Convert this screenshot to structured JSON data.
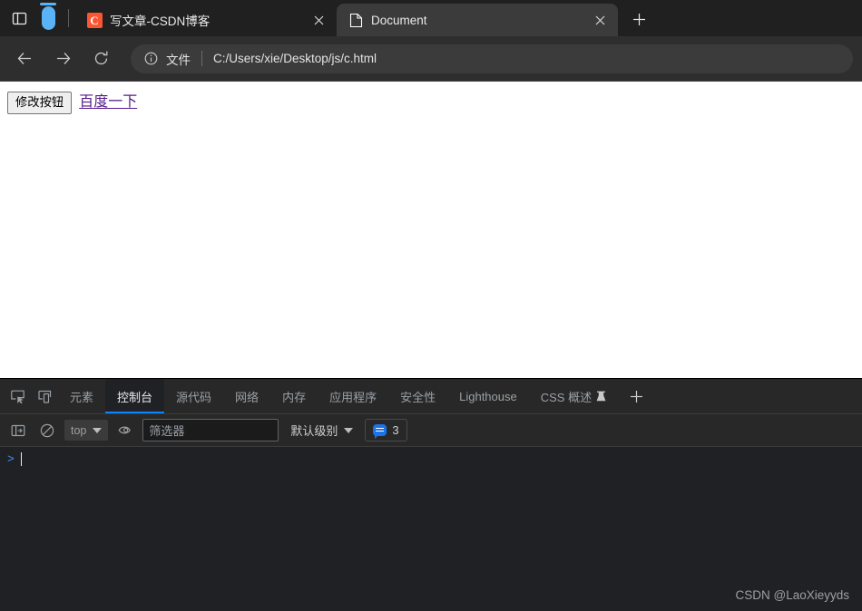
{
  "browser": {
    "tabstrip": {
      "tab_list_icon": "tab-list-icon",
      "vertical_tabs_icon": "vertical-tabs-icon",
      "new_tab_label": "+",
      "tabs": [
        {
          "title": "写文章-CSDN博客",
          "favicon": "csdn-favicon",
          "favicon_letter": "C",
          "active": false,
          "close_label": "✕"
        },
        {
          "title": "Document",
          "favicon": "document-favicon",
          "active": true,
          "close_label": "✕"
        }
      ]
    },
    "toolbar": {
      "back_label": "←",
      "forward_label": "→",
      "refresh_label": "⟳",
      "omnibox": {
        "info_icon": "info-icon",
        "scheme_label": "文件",
        "url": "C:/Users/xie/Desktop/js/c.html"
      }
    }
  },
  "page": {
    "button_label": "修改按钮",
    "link_label": "百度一下",
    "link_color": "#551a8b"
  },
  "devtools": {
    "inspect_icon": "inspect-element-icon",
    "device_toolbar_icon": "device-toolbar-icon",
    "tabs": [
      {
        "label": "元素",
        "active": false
      },
      {
        "label": "控制台",
        "active": true
      },
      {
        "label": "源代码",
        "active": false
      },
      {
        "label": "网络",
        "active": false
      },
      {
        "label": "内存",
        "active": false
      },
      {
        "label": "应用程序",
        "active": false
      },
      {
        "label": "安全性",
        "active": false
      },
      {
        "label": "Lighthouse",
        "active": false
      },
      {
        "label": "CSS 概述",
        "active": false,
        "icon": "flask-icon"
      }
    ],
    "more_tabs_label": "+",
    "console_toolbar": {
      "sidebar_icon": "console-sidebar-icon",
      "clear_icon": "clear-console-icon",
      "context_value": "top",
      "eye_icon": "live-expression-icon",
      "filter_placeholder": "筛选器",
      "filter_value": "",
      "level_value": "默认级别",
      "message_count": "3",
      "message_icon": "message-bubble-icon"
    },
    "console": {
      "prompt_symbol": ">",
      "input_value": ""
    },
    "accent_color": "#0b84ff",
    "watermark": "CSDN @LaoXieyyds"
  }
}
